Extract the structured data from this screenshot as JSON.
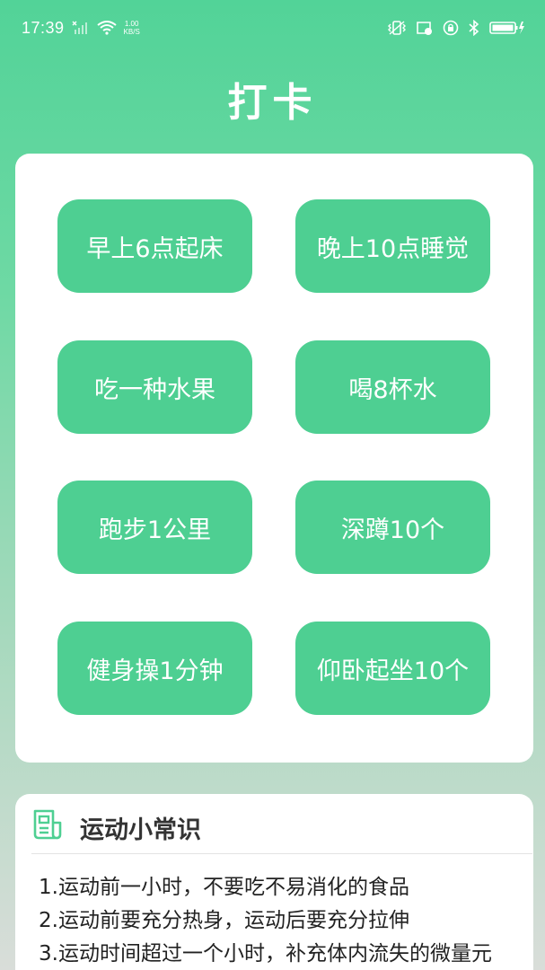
{
  "status_bar": {
    "time": "17:39",
    "net_speed_value": "1.00",
    "net_speed_unit": "KB/S",
    "icons": [
      "no-sim-signal-icon",
      "wifi-icon",
      "vibrate-icon",
      "sd-card-icon",
      "alarm-lock-icon",
      "bluetooth-icon",
      "battery-charging-icon"
    ]
  },
  "header": {
    "title": "打卡"
  },
  "checkin": {
    "items": [
      {
        "label": "早上6点起床"
      },
      {
        "label": "晚上10点睡觉"
      },
      {
        "label": "吃一种水果"
      },
      {
        "label": "喝8杯水"
      },
      {
        "label": "跑步1公里"
      },
      {
        "label": "深蹲10个"
      },
      {
        "label": "健身操1分钟"
      },
      {
        "label": "仰卧起坐10个"
      }
    ]
  },
  "tips": {
    "icon": "document-icon",
    "title": "运动小常识",
    "lines": [
      "1.运动前一小时，不要吃不易消化的食品",
      "2.运动前要充分热身，运动后要充分拉伸",
      "3.运动时间超过一个小时，补充体内流失的微量元"
    ]
  },
  "colors": {
    "accent": "#4ecf92",
    "background_top": "#52d398",
    "card": "#ffffff"
  }
}
